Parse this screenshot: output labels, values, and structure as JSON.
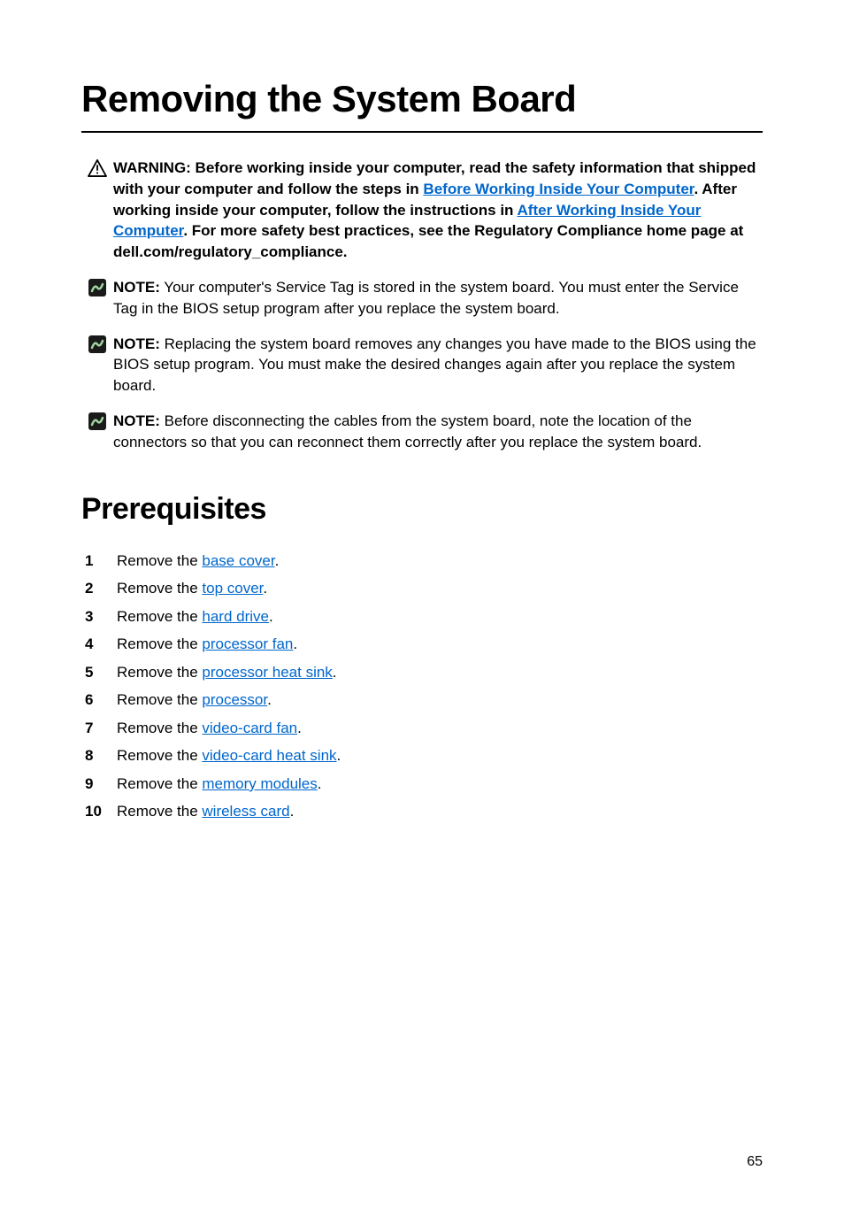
{
  "title": "Removing the System Board",
  "warning": {
    "prefix": "WARNING: Before working inside your computer, read the safety information that shipped with your computer and follow the steps in ",
    "link1": "Before Working Inside Your Computer",
    "mid1": ". After working inside your computer, follow the instructions in ",
    "link2": "After Working Inside Your Computer",
    "suffix": ". For more safety best practices, see the Regulatory Compliance home page at dell.com/regulatory_compliance."
  },
  "notes": [
    {
      "strong": "NOTE:",
      "text": " Your computer's Service Tag is stored in the system board. You must enter the Service Tag in the BIOS setup program after you replace the system board."
    },
    {
      "strong": "NOTE:",
      "text": " Replacing the system board removes any changes you have made to the BIOS using the BIOS setup program. You must make the desired changes again after you replace the system board."
    },
    {
      "strong": "NOTE:",
      "text": " Before disconnecting the cables from the system board, note the location of the connectors so that you can reconnect them correctly after you replace the system board."
    }
  ],
  "prerequisitesHeading": "Prerequisites",
  "steps": [
    {
      "num": "1",
      "pre": "Remove the ",
      "link": "base cover",
      "post": "."
    },
    {
      "num": "2",
      "pre": "Remove the ",
      "link": "top cover",
      "post": "."
    },
    {
      "num": "3",
      "pre": "Remove the ",
      "link": "hard drive",
      "post": "."
    },
    {
      "num": "4",
      "pre": "Remove the ",
      "link": "processor fan",
      "post": "."
    },
    {
      "num": "5",
      "pre": "Remove the ",
      "link": "processor heat sink",
      "post": "."
    },
    {
      "num": "6",
      "pre": "Remove the ",
      "link": "processor",
      "post": "."
    },
    {
      "num": "7",
      "pre": "Remove the ",
      "link": "video-card fan",
      "post": "."
    },
    {
      "num": "8",
      "pre": "Remove the ",
      "link": "video-card heat sink",
      "post": "."
    },
    {
      "num": "9",
      "pre": "Remove the ",
      "link": "memory modules",
      "post": "."
    },
    {
      "num": "10",
      "pre": "Remove the ",
      "link": "wireless card",
      "post": "."
    }
  ],
  "pageNumber": "65"
}
